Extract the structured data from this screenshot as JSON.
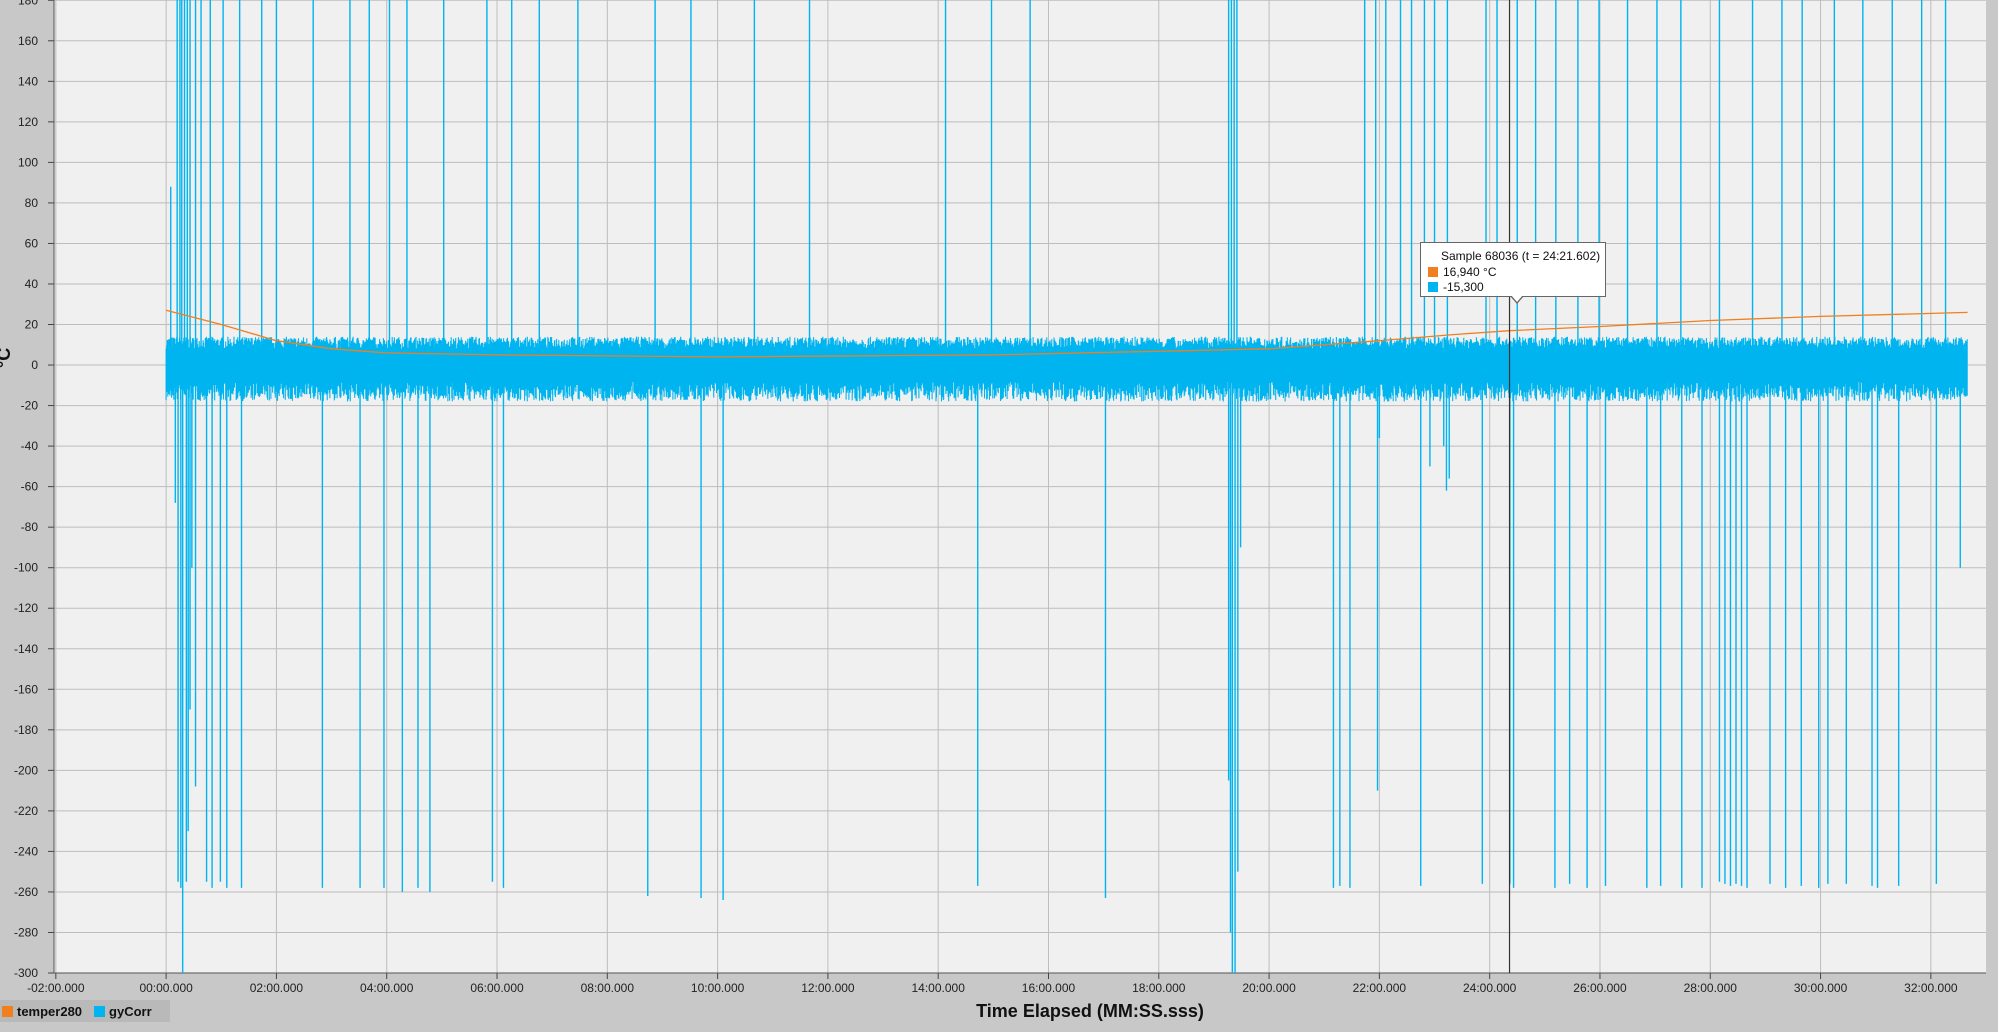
{
  "chart_data": {
    "type": "line",
    "xlabel": "Time Elapsed (MM:SS.sss)",
    "ylabel": "°C",
    "xlim": [
      -122,
      1980
    ],
    "ylim": [
      -300,
      190
    ],
    "x_ticks": [
      {
        "value": -120,
        "label": "-02:00.000"
      },
      {
        "value": 0,
        "label": "00:00.000"
      },
      {
        "value": 120,
        "label": "02:00.000"
      },
      {
        "value": 240,
        "label": "04:00.000"
      },
      {
        "value": 360,
        "label": "06:00.000"
      },
      {
        "value": 480,
        "label": "08:00.000"
      },
      {
        "value": 600,
        "label": "10:00.000"
      },
      {
        "value": 720,
        "label": "12:00.000"
      },
      {
        "value": 840,
        "label": "14:00.000"
      },
      {
        "value": 960,
        "label": "16:00.000"
      },
      {
        "value": 1080,
        "label": "18:00.000"
      },
      {
        "value": 1200,
        "label": "20:00.000"
      },
      {
        "value": 1320,
        "label": "22:00.000"
      },
      {
        "value": 1440,
        "label": "24:00.000"
      },
      {
        "value": 1560,
        "label": "26:00.000"
      },
      {
        "value": 1680,
        "label": "28:00.000"
      },
      {
        "value": 1800,
        "label": "30:00.000"
      },
      {
        "value": 1920,
        "label": "32:00.000"
      }
    ],
    "y_ticks": [
      180,
      160,
      140,
      120,
      100,
      80,
      60,
      40,
      20,
      0,
      -20,
      -40,
      -60,
      -80,
      -100,
      -120,
      -140,
      -160,
      -180,
      -200,
      -220,
      -240,
      -260,
      -280,
      -300
    ],
    "grid": true,
    "legend_position": "bottom-left",
    "series": [
      {
        "name": "temper280",
        "color": "#f07f1f",
        "x": [
          0,
          60,
          120,
          180,
          240,
          360,
          600,
          900,
          1200,
          1320,
          1400,
          1461.6,
          1560,
          1680,
          1800,
          1960
        ],
        "y": [
          27,
          20,
          12,
          8,
          6,
          5,
          4,
          5,
          8,
          12,
          15,
          16.94,
          19,
          22,
          24,
          26
        ]
      },
      {
        "name": "gyCorr",
        "color": "#00b4f0",
        "baseline_y": [
          -8,
          8
        ],
        "x_range": [
          0,
          1960
        ],
        "downward_spikes": [
          {
            "x": 10,
            "y": -68
          },
          {
            "x": 13,
            "y": -255
          },
          {
            "x": 16,
            "y": -258
          },
          {
            "x": 18,
            "y": -300
          },
          {
            "x": 22,
            "y": -255
          },
          {
            "x": 24,
            "y": -230
          },
          {
            "x": 26,
            "y": -170
          },
          {
            "x": 28,
            "y": -100
          },
          {
            "x": 32,
            "y": -208
          },
          {
            "x": 44,
            "y": -255
          },
          {
            "x": 50,
            "y": -258
          },
          {
            "x": 59,
            "y": -255
          },
          {
            "x": 66,
            "y": -258
          },
          {
            "x": 82,
            "y": -258
          },
          {
            "x": 170,
            "y": -258
          },
          {
            "x": 211,
            "y": -258
          },
          {
            "x": 237,
            "y": -258
          },
          {
            "x": 257,
            "y": -260
          },
          {
            "x": 274,
            "y": -258
          },
          {
            "x": 287,
            "y": -260
          },
          {
            "x": 355,
            "y": -255
          },
          {
            "x": 367,
            "y": -258
          },
          {
            "x": 524,
            "y": -262
          },
          {
            "x": 582,
            "y": -263
          },
          {
            "x": 606,
            "y": -264
          },
          {
            "x": 883,
            "y": -257
          },
          {
            "x": 1022,
            "y": -263
          },
          {
            "x": 1156,
            "y": -205
          },
          {
            "x": 1158,
            "y": -280
          },
          {
            "x": 1160,
            "y": -300
          },
          {
            "x": 1163,
            "y": -300
          },
          {
            "x": 1166,
            "y": -250
          },
          {
            "x": 1169,
            "y": -90
          },
          {
            "x": 1270,
            "y": -258
          },
          {
            "x": 1277,
            "y": -257
          },
          {
            "x": 1288,
            "y": -258
          },
          {
            "x": 1318,
            "y": -210
          },
          {
            "x": 1320,
            "y": -36
          },
          {
            "x": 1365,
            "y": -257
          },
          {
            "x": 1375,
            "y": -50
          },
          {
            "x": 1390,
            "y": -40
          },
          {
            "x": 1393,
            "y": -62
          },
          {
            "x": 1396,
            "y": -56
          },
          {
            "x": 1432,
            "y": -256
          },
          {
            "x": 1462,
            "y": -256
          },
          {
            "x": 1466,
            "y": -258
          },
          {
            "x": 1511,
            "y": -258
          },
          {
            "x": 1527,
            "y": -256
          },
          {
            "x": 1546,
            "y": -258
          },
          {
            "x": 1566,
            "y": -257
          },
          {
            "x": 1611,
            "y": -258
          },
          {
            "x": 1626,
            "y": -257
          },
          {
            "x": 1649,
            "y": -258
          },
          {
            "x": 1671,
            "y": -258
          },
          {
            "x": 1690,
            "y": -255
          },
          {
            "x": 1696,
            "y": -256
          },
          {
            "x": 1702,
            "y": -257
          },
          {
            "x": 1708,
            "y": -256
          },
          {
            "x": 1714,
            "y": -257
          },
          {
            "x": 1720,
            "y": -258
          },
          {
            "x": 1745,
            "y": -256
          },
          {
            "x": 1762,
            "y": -258
          },
          {
            "x": 1779,
            "y": -257
          },
          {
            "x": 1798,
            "y": -258
          },
          {
            "x": 1808,
            "y": -256
          },
          {
            "x": 1828,
            "y": -256
          },
          {
            "x": 1856,
            "y": -257
          },
          {
            "x": 1862,
            "y": -258
          },
          {
            "x": 1885,
            "y": -257
          },
          {
            "x": 1926,
            "y": -256
          },
          {
            "x": 1952,
            "y": -100
          }
        ],
        "upward_spikes": [
          {
            "x": 5,
            "y": 88
          },
          {
            "x": 12,
            "y": 190
          },
          {
            "x": 15,
            "y": 190
          },
          {
            "x": 17,
            "y": 190
          },
          {
            "x": 20,
            "y": 190
          },
          {
            "x": 23,
            "y": 190
          },
          {
            "x": 26,
            "y": 190
          },
          {
            "x": 32,
            "y": 190
          },
          {
            "x": 38,
            "y": 190
          },
          {
            "x": 48,
            "y": 190
          },
          {
            "x": 62,
            "y": 190
          },
          {
            "x": 80,
            "y": 190
          },
          {
            "x": 104,
            "y": 190
          },
          {
            "x": 120,
            "y": 190
          },
          {
            "x": 160,
            "y": 190
          },
          {
            "x": 200,
            "y": 190
          },
          {
            "x": 221,
            "y": 190
          },
          {
            "x": 243,
            "y": 190
          },
          {
            "x": 262,
            "y": 190
          },
          {
            "x": 302,
            "y": 190
          },
          {
            "x": 349,
            "y": 190
          },
          {
            "x": 376,
            "y": 190
          },
          {
            "x": 406,
            "y": 190
          },
          {
            "x": 448,
            "y": 190
          },
          {
            "x": 532,
            "y": 190
          },
          {
            "x": 571,
            "y": 190
          },
          {
            "x": 640,
            "y": 190
          },
          {
            "x": 700,
            "y": 190
          },
          {
            "x": 848,
            "y": 190
          },
          {
            "x": 898,
            "y": 190
          },
          {
            "x": 940,
            "y": 190
          },
          {
            "x": 1156,
            "y": 190
          },
          {
            "x": 1159,
            "y": 190
          },
          {
            "x": 1162,
            "y": 190
          },
          {
            "x": 1165,
            "y": 190
          },
          {
            "x": 1304,
            "y": 190
          },
          {
            "x": 1316,
            "y": 190
          },
          {
            "x": 1327,
            "y": 190
          },
          {
            "x": 1343,
            "y": 190
          },
          {
            "x": 1355,
            "y": 190
          },
          {
            "x": 1369,
            "y": 190
          },
          {
            "x": 1380,
            "y": 190
          },
          {
            "x": 1394,
            "y": 190
          },
          {
            "x": 1436,
            "y": 190
          },
          {
            "x": 1448,
            "y": 190
          },
          {
            "x": 1470,
            "y": 190
          },
          {
            "x": 1490,
            "y": 190
          },
          {
            "x": 1512,
            "y": 190
          },
          {
            "x": 1536,
            "y": 190
          },
          {
            "x": 1559,
            "y": 190
          },
          {
            "x": 1590,
            "y": 190
          },
          {
            "x": 1622,
            "y": 190
          },
          {
            "x": 1648,
            "y": 190
          },
          {
            "x": 1690,
            "y": 190
          },
          {
            "x": 1726,
            "y": 190
          },
          {
            "x": 1758,
            "y": 190
          },
          {
            "x": 1780,
            "y": 190
          },
          {
            "x": 1815,
            "y": 190
          },
          {
            "x": 1846,
            "y": 190
          },
          {
            "x": 1878,
            "y": 190
          },
          {
            "x": 1910,
            "y": 190
          },
          {
            "x": 1936,
            "y": 190
          }
        ]
      }
    ],
    "cursor": {
      "x": 1461.6
    }
  },
  "legend": {
    "items": [
      {
        "label": "temper280",
        "color": "#f07f1f"
      },
      {
        "label": "gyCorr",
        "color": "#00b4f0"
      }
    ]
  },
  "tooltip": {
    "title": "Sample 68036 (t = 24:21.602)",
    "rows": [
      {
        "text": "16,940 °C",
        "color": "#f07f1f"
      },
      {
        "text": "-15,300",
        "color": "#00b4f0"
      }
    ]
  }
}
